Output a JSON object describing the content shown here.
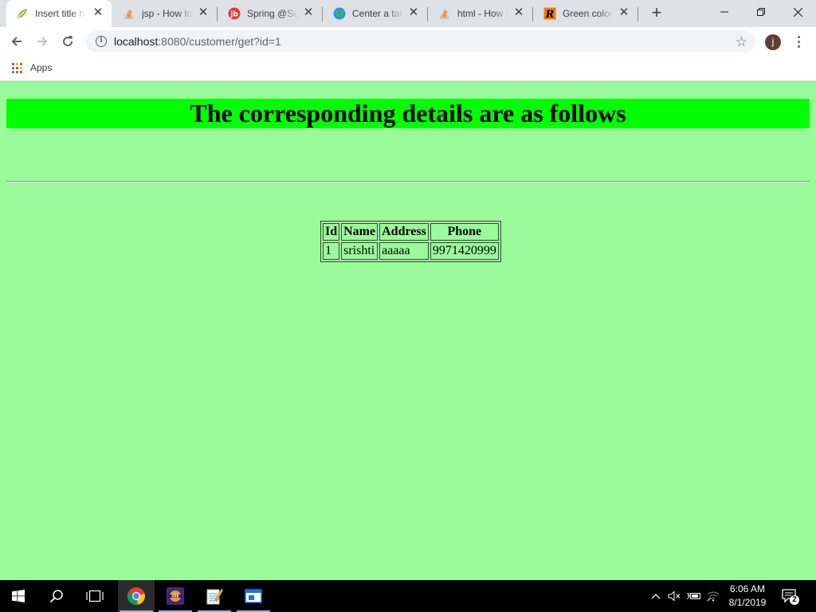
{
  "browser": {
    "tabs": [
      {
        "title": "Insert title here",
        "favicon": "leaf-icon",
        "active": true
      },
      {
        "title": "jsp - How to",
        "favicon": "stackoverflow-icon",
        "active": false
      },
      {
        "title": "Spring @Service",
        "favicon": "spring-icon",
        "active": false
      },
      {
        "title": "Center a table",
        "favicon": "globe-icon",
        "active": false
      },
      {
        "title": "html - How to",
        "favicon": "stackoverflow-icon",
        "active": false
      },
      {
        "title": "Green color",
        "favicon": "r-icon",
        "active": false
      }
    ],
    "address": {
      "host": "localhost",
      "path": ":8080/customer/get?id=1"
    },
    "profile_initial": "j",
    "bookmarks": {
      "apps_label": "Apps"
    }
  },
  "page": {
    "heading": "The corresponding details are as follows",
    "background_color": "#9afa9a",
    "heading_color": "#00ff00",
    "table": {
      "headers": [
        "Id",
        "Name",
        "Address",
        "Phone"
      ],
      "rows": [
        [
          "1",
          "srishti",
          "aaaaa",
          "9971420999"
        ]
      ]
    }
  },
  "taskbar": {
    "time": "6:06 AM",
    "date": "8/1/2019",
    "notification_count": "2"
  }
}
